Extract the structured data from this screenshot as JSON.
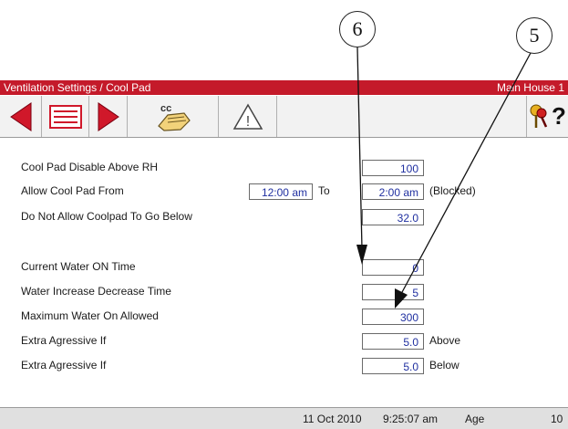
{
  "callouts": {
    "six": "6",
    "five": "5"
  },
  "titlebar": {
    "title": "Ventilation Settings / Cool Pad",
    "house": "Main House 1"
  },
  "toolbar": {
    "back_icon": "arrow-left-icon",
    "menu_icon": "screen-list-icon",
    "forward_icon": "arrow-right-icon",
    "cc_label": "cc",
    "alarm_icon": "warning-triangle-icon",
    "alarm_glyph": "!",
    "keys_icon": "keys-icon",
    "help_glyph": "?"
  },
  "settings": {
    "disable_rh": {
      "label": "Cool Pad Disable Above RH",
      "value": "100"
    },
    "allow_from": {
      "label": "Allow Cool Pad From",
      "from": "12:00 am",
      "to_label": "To",
      "to": "2:00 am",
      "status": "(Blocked)"
    },
    "not_below": {
      "label": "Do Not Allow Coolpad To Go Below",
      "value": "32.0"
    },
    "water_on_time": {
      "label": "Current Water ON Time",
      "value": "0"
    },
    "water_incdec": {
      "label": "Water Increase Decrease Time",
      "value": "5"
    },
    "max_water": {
      "label": "Maximum Water On Allowed",
      "value": "300"
    },
    "extra_above": {
      "label": "Extra Agressive If",
      "value": "5.0",
      "suffix": "Above"
    },
    "extra_below": {
      "label": "Extra Agressive If",
      "value": "5.0",
      "suffix": "Below"
    }
  },
  "status": {
    "date": "11 Oct 2010",
    "time": "9:25:07 am",
    "age_label": "Age",
    "age_value": "10"
  },
  "colors": {
    "title_red": "#c41a2a",
    "value_blue": "#1f2fa0"
  }
}
